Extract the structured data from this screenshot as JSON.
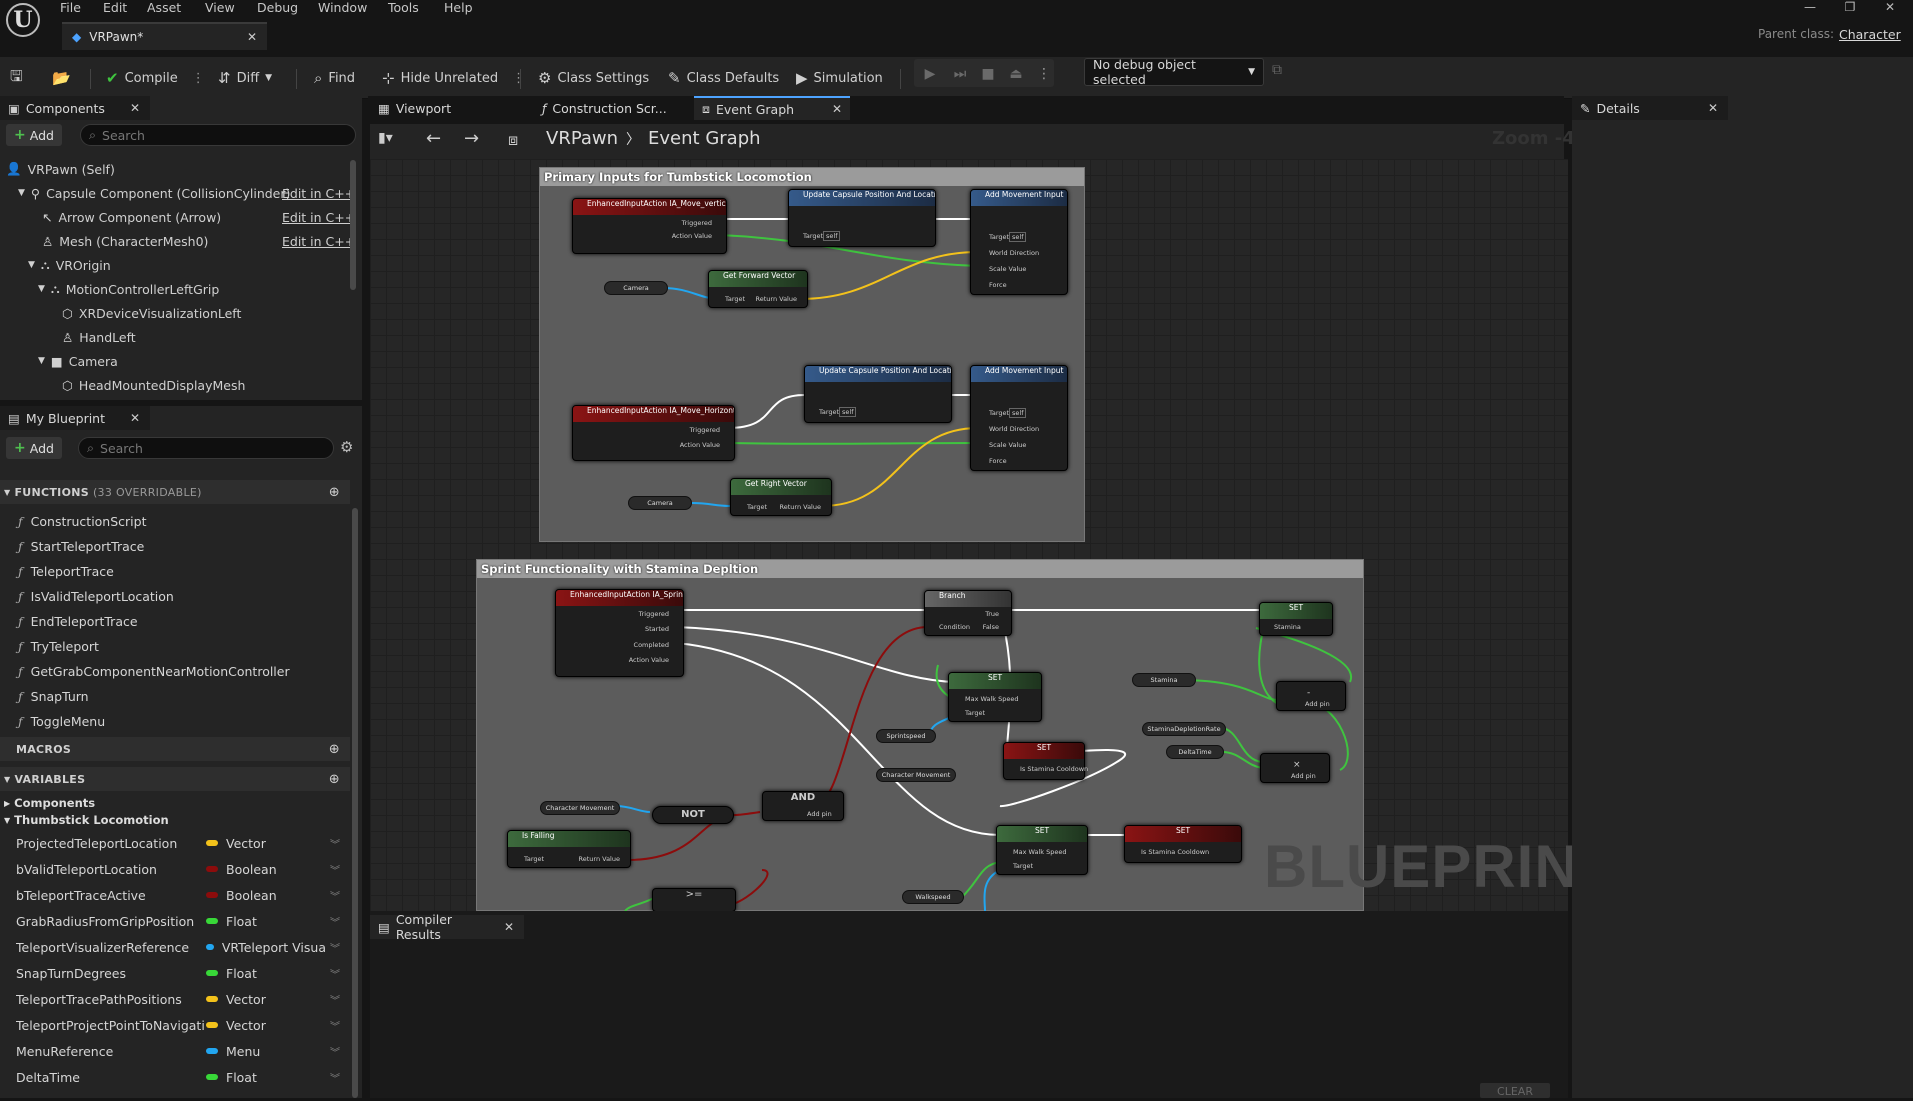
{
  "menu": [
    "File",
    "Edit",
    "Asset",
    "View",
    "Debug",
    "Window",
    "Tools",
    "Help"
  ],
  "doc_tab": "VRPawn*",
  "parent_class_label": "Parent class:",
  "parent_class_value": "Character",
  "toolbar": {
    "compile": "Compile",
    "diff": "Diff",
    "find": "Find",
    "hide_unrelated": "Hide Unrelated",
    "class_settings": "Class Settings",
    "class_defaults": "Class Defaults",
    "simulation": "Simulation",
    "debug_select": "No debug object selected"
  },
  "components": {
    "tab": "Components",
    "add": "Add",
    "search_placeholder": "Search",
    "items": [
      {
        "label": "VRPawn (Self)",
        "edit": ""
      },
      {
        "label": "Capsule Component (CollisionCylinder)",
        "edit": "Edit in C++"
      },
      {
        "label": "Arrow Component (Arrow)",
        "edit": "Edit in C++"
      },
      {
        "label": "Mesh (CharacterMesh0)",
        "edit": "Edit in C++"
      },
      {
        "label": "VROrigin",
        "edit": ""
      },
      {
        "label": "MotionControllerLeftGrip",
        "edit": ""
      },
      {
        "label": "XRDeviceVisualizationLeft",
        "edit": ""
      },
      {
        "label": "HandLeft",
        "edit": ""
      },
      {
        "label": "Camera",
        "edit": ""
      },
      {
        "label": "HeadMountedDisplayMesh",
        "edit": ""
      }
    ]
  },
  "my_blueprint": {
    "tab": "My Blueprint",
    "add": "Add",
    "search_placeholder": "Search",
    "functions_header": "FUNCTIONS",
    "functions_count": "(33 OVERRIDABLE)",
    "functions": [
      "ConstructionScript",
      "StartTeleportTrace",
      "TeleportTrace",
      "IsValidTeleportLocation",
      "EndTeleportTrace",
      "TryTeleport",
      "GetGrabComponentNearMotionController",
      "SnapTurn",
      "ToggleMenu"
    ],
    "macros_header": "MACROS",
    "variables_header": "VARIABLES",
    "var_categories": [
      "Components",
      "Thumbstick Locomotion"
    ],
    "variables": [
      {
        "name": "ProjectedTeleportLocation",
        "type": "Vector",
        "color": "#f3c21b"
      },
      {
        "name": "bValidTeleportLocation",
        "type": "Boolean",
        "color": "#8c0c0c"
      },
      {
        "name": "bTeleportTraceActive",
        "type": "Boolean",
        "color": "#8c0c0c"
      },
      {
        "name": "GrabRadiusFromGripPosition",
        "type": "Float",
        "color": "#38d838"
      },
      {
        "name": "TeleportVisualizerReference",
        "type": "VRTeleport Visua",
        "color": "#22a6f0"
      },
      {
        "name": "SnapTurnDegrees",
        "type": "Float",
        "color": "#38d838"
      },
      {
        "name": "TeleportTracePathPositions",
        "type": "Vector",
        "color": "#f3c21b"
      },
      {
        "name": "TeleportProjectPointToNavigati",
        "type": "Vector",
        "color": "#f3c21b"
      },
      {
        "name": "MenuReference",
        "type": "Menu",
        "color": "#22a6f0"
      },
      {
        "name": "DeltaTime",
        "type": "Float",
        "color": "#38d838"
      }
    ]
  },
  "editor_tabs": {
    "viewport": "Viewport",
    "construction": "Construction Scr...",
    "event_graph": "Event Graph"
  },
  "breadcrumb": {
    "root": "VRPawn",
    "current": "Event Graph"
  },
  "zoom": "Zoom -4",
  "details_tab": "Details",
  "compiler_tab": "Compiler Results",
  "clear_button": "CLEAR",
  "watermark": "BLUEPRINT",
  "graph": {
    "comment1": "Primary Inputs for Tumbstick Locomotion",
    "comment2": "Sprint Functionality with Stamina Depltion",
    "nodes": {
      "ia_move_vertical": "EnhancedInputAction IA_Move_vertical",
      "update_capsule_1": "Update Capsule Position And Location",
      "add_movement_1": "Add Movement Input",
      "camera_1": "Camera",
      "get_forward": "Get Forward Vector",
      "ia_move_horizontal": "EnhancedInputAction IA_Move_Horizontal",
      "update_capsule_2": "Update Capsule Position And Location",
      "add_movement_2": "Add Movement Input",
      "camera_2": "Camera",
      "get_right": "Get Right Vector",
      "ia_sprint": "EnhancedInputAction IA_Sprint",
      "branch": "Branch",
      "set": "SET",
      "not": "NOT",
      "and": "AND",
      "is_falling": "Is Falling",
      "char_movement": "Character Movement",
      "sprint_speed": "Sprintspeed",
      "stamina": "Stamina",
      "stamina_rate": "StaminaDepletionRate",
      "delta_time": "DeltaTime",
      "walk_speed": "Walkspeed",
      "add_pin": "Add pin"
    },
    "pins": {
      "triggered": "Triggered",
      "started": "Started",
      "completed": "Completed",
      "action_value": "Action Value",
      "target": "Target",
      "self": "self",
      "world_direction": "World Direction",
      "scale_value": "Scale Value",
      "force": "Force",
      "return_value": "Return Value",
      "condition": "Condition",
      "true": "True",
      "false": "False",
      "max_walk_speed": "Max Walk Speed",
      "is_stamina_cooldown": "Is Stamina Cooldown"
    }
  }
}
